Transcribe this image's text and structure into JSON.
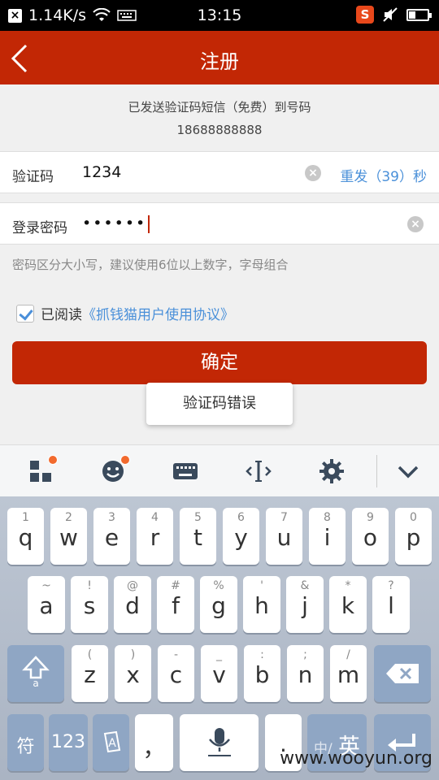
{
  "status_bar": {
    "net_speed": "1.14K/s",
    "time": "13:15",
    "ime_icon_letter": "S"
  },
  "app_bar": {
    "title": "注册"
  },
  "info": {
    "line1": "已发送验证码短信（免费）到号码",
    "phone": "18688888888"
  },
  "verify_row": {
    "label": "验证码",
    "value": "1234",
    "resend": "重发（39）秒"
  },
  "password_row": {
    "label": "登录密码",
    "value": "••••••"
  },
  "hint": "密码区分大小写，建议使用6位以上数字，字母组合",
  "agreement": {
    "prefix": "已阅读",
    "link": "《抓钱猫用户使用协议》",
    "checked": true
  },
  "confirm_button": "确定",
  "toast": "验证码错误",
  "keyboard": {
    "row1": [
      {
        "sub": "1",
        "key": "q"
      },
      {
        "sub": "2",
        "key": "w"
      },
      {
        "sub": "3",
        "key": "e"
      },
      {
        "sub": "4",
        "key": "r"
      },
      {
        "sub": "5",
        "key": "t"
      },
      {
        "sub": "6",
        "key": "y"
      },
      {
        "sub": "7",
        "key": "u"
      },
      {
        "sub": "8",
        "key": "i"
      },
      {
        "sub": "9",
        "key": "o"
      },
      {
        "sub": "0",
        "key": "p"
      }
    ],
    "row2": [
      {
        "sub": "~",
        "key": "a"
      },
      {
        "sub": "!",
        "key": "s"
      },
      {
        "sub": "@",
        "key": "d"
      },
      {
        "sub": "#",
        "key": "f"
      },
      {
        "sub": "%",
        "key": "g"
      },
      {
        "sub": "'",
        "key": "h"
      },
      {
        "sub": "&",
        "key": "j"
      },
      {
        "sub": "*",
        "key": "k"
      },
      {
        "sub": "?",
        "key": "l"
      }
    ],
    "row3": [
      {
        "sub": "(",
        "key": "z"
      },
      {
        "sub": ")",
        "key": "x"
      },
      {
        "sub": "-",
        "key": "c"
      },
      {
        "sub": "_",
        "key": "v"
      },
      {
        "sub": ":",
        "key": "b"
      },
      {
        "sub": ";",
        "key": "n"
      },
      {
        "sub": "/",
        "key": "m"
      }
    ],
    "symbol_key": "符",
    "num_key": "123",
    "comma_key": "，",
    "period_key": ".",
    "lang_key_small": "中/",
    "lang_key_big": "英"
  },
  "watermark": "www.wooyun.org",
  "colors": {
    "brand_red": "#c22705",
    "link_blue": "#4a90d9",
    "badge_orange": "#f26a2e"
  }
}
